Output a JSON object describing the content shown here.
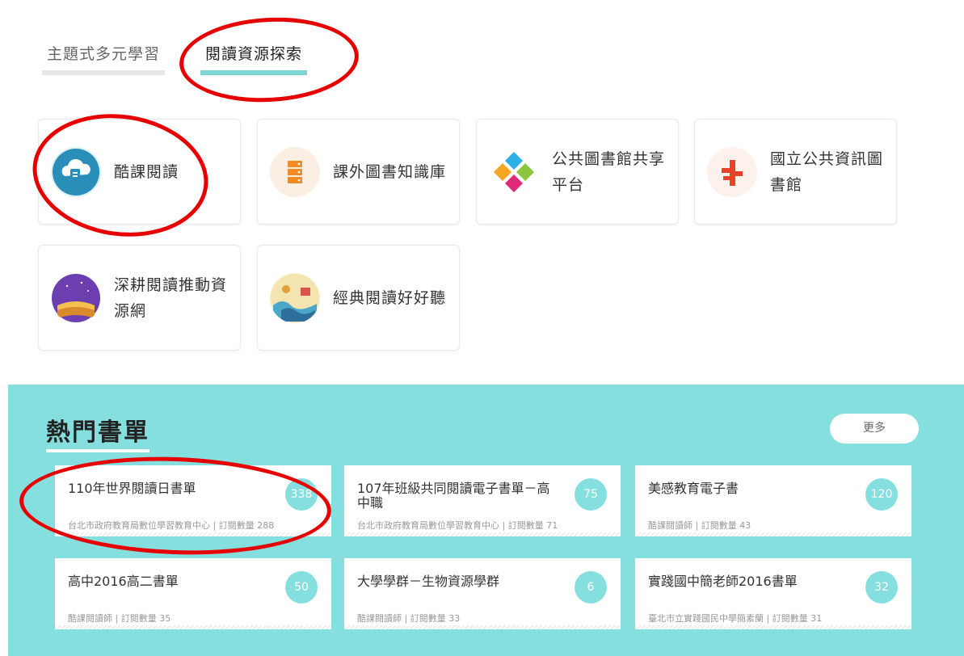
{
  "tabs": [
    {
      "label": "主題式多元學習"
    },
    {
      "label": "閱讀資源探索"
    }
  ],
  "resources": [
    {
      "label": "酷課閱讀",
      "icon": "cloud-book-icon"
    },
    {
      "label": "課外圖書知識庫",
      "icon": "server-stack-icon"
    },
    {
      "label": "公共圖書館共享平台",
      "icon": "diamond-tiles-icon"
    },
    {
      "label": "國立公共資訊圖書館",
      "icon": "library-logo-icon"
    },
    {
      "label": "深耕閱讀推動資源網",
      "icon": "night-book-icon"
    },
    {
      "label": "經典閱讀好好聽",
      "icon": "classic-illustration-icon"
    }
  ],
  "booklists": {
    "title": "熱門書單",
    "more_label": "更多",
    "items": [
      {
        "title": "110年世界閱讀日書單",
        "meta": "台北市政府教育局數位學習教育中心 | 訂閱數量 288",
        "count": "338"
      },
      {
        "title": "107年班級共同閱讀電子書單－高中職",
        "meta": "台北市政府教育局數位學習教育中心 | 訂閱數量 71",
        "count": "75"
      },
      {
        "title": "美感教育電子書",
        "meta": "酷課閱讀師 | 訂閱數量 43",
        "count": "120"
      },
      {
        "title": "高中2016高二書單",
        "meta": "酷課閱讀師 | 訂閱數量 35",
        "count": "50"
      },
      {
        "title": "大學學群－生物資源學群",
        "meta": "酷課閱讀師 | 訂閱數量 33",
        "count": "6"
      },
      {
        "title": "實踐國中簡老師2016書單",
        "meta": "臺北市立實踐國民中學簡素蘭 | 訂閱數量 31",
        "count": "32"
      }
    ]
  },
  "colors": {
    "accent": "#86dfdf",
    "tab_underline": "#7ed6d4",
    "annotation_red": "#e60000"
  }
}
